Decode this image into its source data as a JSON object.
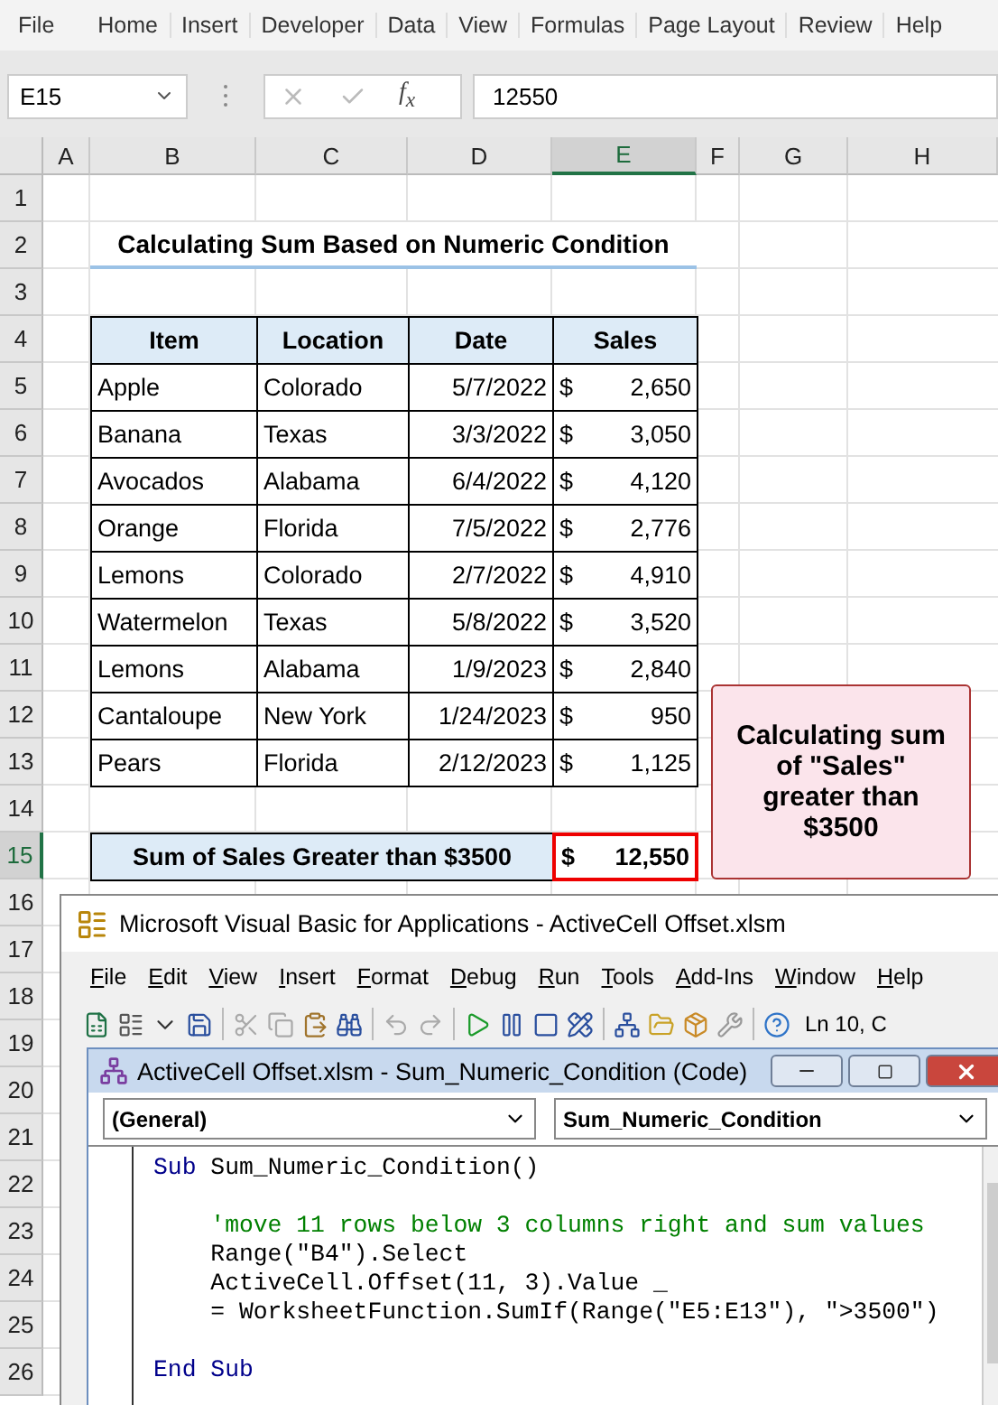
{
  "ribbon_tabs": [
    "File",
    "Home",
    "Insert",
    "Developer",
    "Data",
    "View",
    "Formulas",
    "Page Layout",
    "Review",
    "Help"
  ],
  "name_box": {
    "value": "E15"
  },
  "formula_bar": {
    "function_label": "f$_{x}$",
    "value": "12550"
  },
  "columns": [
    {
      "label": "A",
      "selected": false
    },
    {
      "label": "B",
      "selected": false
    },
    {
      "label": "C",
      "selected": false
    },
    {
      "label": "D",
      "selected": false
    },
    {
      "label": "E",
      "selected": true
    },
    {
      "label": "F",
      "selected": false
    },
    {
      "label": "G",
      "selected": false
    },
    {
      "label": "H",
      "selected": false
    }
  ],
  "rows": [
    {
      "label": "1",
      "selected": false
    },
    {
      "label": "2",
      "selected": false
    },
    {
      "label": "3",
      "selected": false
    },
    {
      "label": "4",
      "selected": false
    },
    {
      "label": "5",
      "selected": false
    },
    {
      "label": "6",
      "selected": false
    },
    {
      "label": "7",
      "selected": false
    },
    {
      "label": "8",
      "selected": false
    },
    {
      "label": "9",
      "selected": false
    },
    {
      "label": "10",
      "selected": false
    },
    {
      "label": "11",
      "selected": false
    },
    {
      "label": "12",
      "selected": false
    },
    {
      "label": "13",
      "selected": false
    },
    {
      "label": "14",
      "selected": false
    },
    {
      "label": "15",
      "selected": true
    },
    {
      "label": "16",
      "selected": false
    },
    {
      "label": "17",
      "selected": false
    },
    {
      "label": "18",
      "selected": false
    },
    {
      "label": "19",
      "selected": false
    },
    {
      "label": "20",
      "selected": false
    },
    {
      "label": "21",
      "selected": false
    },
    {
      "label": "22",
      "selected": false
    },
    {
      "label": "23",
      "selected": false
    },
    {
      "label": "24",
      "selected": false
    },
    {
      "label": "25",
      "selected": false
    },
    {
      "label": "26",
      "selected": false
    }
  ],
  "sheet": {
    "title": "Calculating Sum Based on Numeric Condition",
    "table": {
      "columns": [
        "Item",
        "Location",
        "Date",
        "Sales"
      ],
      "rows": [
        {
          "item": "Apple",
          "location": "Colorado",
          "date": "5/7/2022",
          "currency": "$",
          "sales": "2,650"
        },
        {
          "item": "Banana",
          "location": "Texas",
          "date": "3/3/2022",
          "currency": "$",
          "sales": "3,050"
        },
        {
          "item": "Avocados",
          "location": "Alabama",
          "date": "6/4/2022",
          "currency": "$",
          "sales": "4,120"
        },
        {
          "item": "Orange",
          "location": "Florida",
          "date": "7/5/2022",
          "currency": "$",
          "sales": "2,776"
        },
        {
          "item": "Lemons",
          "location": "Colorado",
          "date": "2/7/2022",
          "currency": "$",
          "sales": "4,910"
        },
        {
          "item": "Watermelon",
          "location": "Texas",
          "date": "5/8/2022",
          "currency": "$",
          "sales": "3,520"
        },
        {
          "item": "Lemons",
          "location": "Alabama",
          "date": "1/9/2023",
          "currency": "$",
          "sales": "2,840"
        },
        {
          "item": "Cantaloupe",
          "location": "New York",
          "date": "1/24/2023",
          "currency": "$",
          "sales": "950"
        },
        {
          "item": "Pears",
          "location": "Florida",
          "date": "2/12/2023",
          "currency": "$",
          "sales": "1,125"
        }
      ]
    },
    "summary": {
      "label": "Sum of Sales Greater than $3500",
      "currency": "$",
      "value": "12,550",
      "selected": true
    },
    "note": "Calculating sum of \"Sales\" greater than $3500"
  },
  "vba": {
    "title": "Microsoft Visual Basic for Applications - ActiveCell Offset.xlsm",
    "menu": [
      "File",
      "Edit",
      "View",
      "Insert",
      "Format",
      "Debug",
      "Run",
      "Tools",
      "Add-Ins",
      "Window",
      "Help"
    ],
    "position": "Ln 10, C",
    "code_window": {
      "title": "ActiveCell Offset.xlsm - Sum_Numeric_Condition (Code)",
      "object": "(General)",
      "procedure": "Sum_Numeric_Condition",
      "lines": [
        {
          "kind": "code",
          "segments": [
            {
              "kind": "keyword",
              "text": "Sub"
            },
            {
              "kind": "plain",
              "text": " Sum_Numeric_Condition()"
            }
          ]
        },
        {
          "kind": "blank"
        },
        {
          "kind": "code",
          "segments": [
            {
              "kind": "comment",
              "text": "    'move 11 rows below 3 columns right and sum values"
            }
          ]
        },
        {
          "kind": "code",
          "segments": [
            {
              "kind": "plain",
              "text": "    Range(\"B4\").Select"
            }
          ]
        },
        {
          "kind": "code",
          "segments": [
            {
              "kind": "plain",
              "text": "    ActiveCell.Offset(11, 3).Value _"
            }
          ]
        },
        {
          "kind": "code",
          "segments": [
            {
              "kind": "plain",
              "text": "    = WorksheetFunction.SumIf(Range(\"E5:E13\"), \">3500\")"
            }
          ]
        },
        {
          "kind": "blank"
        },
        {
          "kind": "code",
          "segments": [
            {
              "kind": "keyword",
              "text": "End Sub"
            }
          ]
        }
      ]
    }
  }
}
